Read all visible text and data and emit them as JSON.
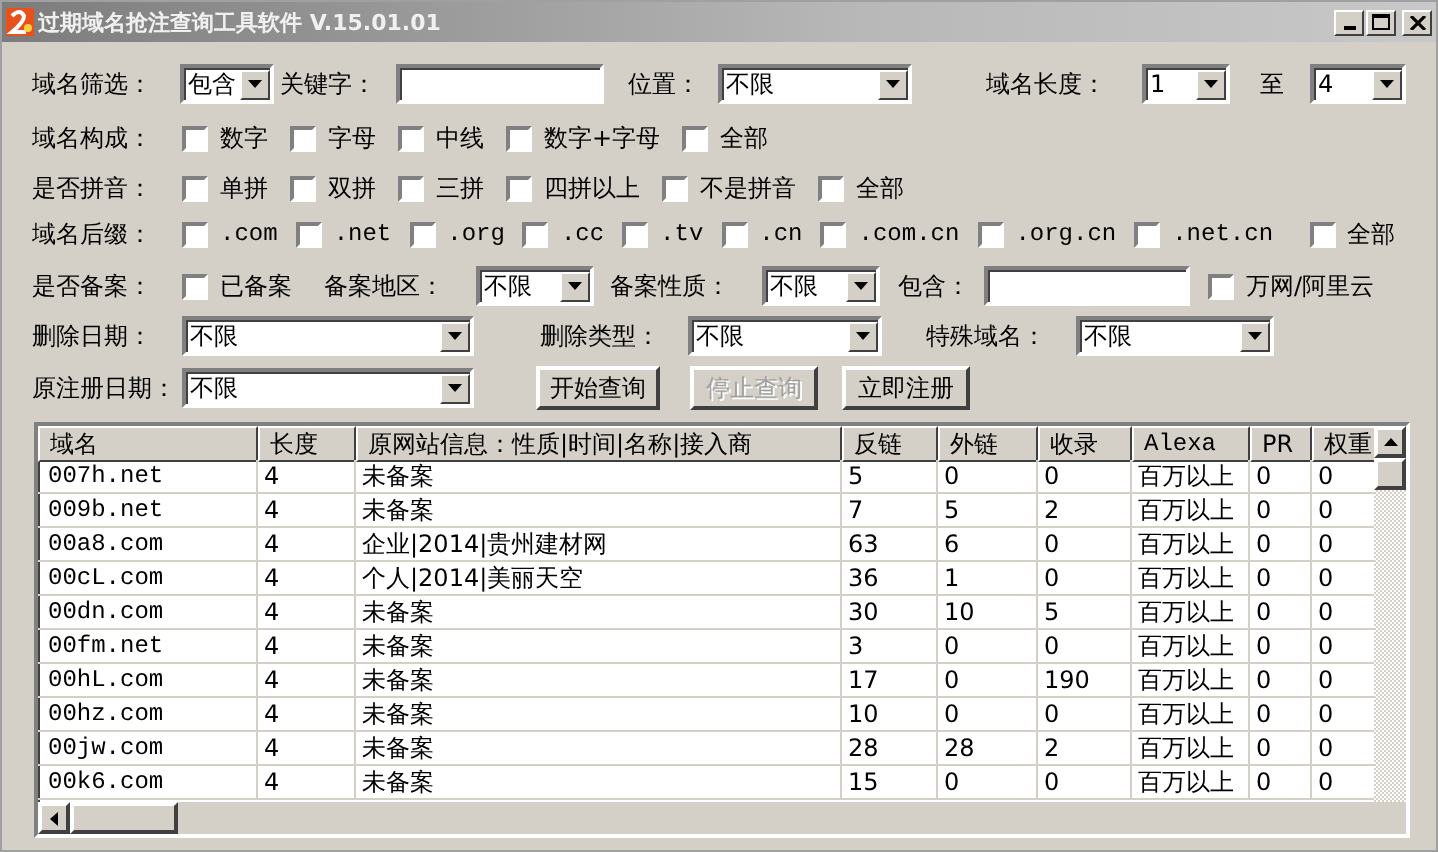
{
  "window": {
    "title": "过期域名抢注查询工具软件 V.15.01.01"
  },
  "form": {
    "rows": [
      {
        "items": [
          {
            "kind": "label",
            "text": "域名筛选："
          },
          {
            "kind": "combo",
            "value": "包含"
          },
          {
            "kind": "label",
            "text": "关键字："
          },
          {
            "kind": "input"
          },
          {
            "kind": "label",
            "text": "位置："
          },
          {
            "kind": "combo",
            "value": "不限"
          },
          {
            "kind": "label",
            "text": "域名长度："
          },
          {
            "kind": "combo",
            "value": "1"
          },
          {
            "kind": "label",
            "text": "至"
          },
          {
            "kind": "combo",
            "value": "4"
          }
        ]
      },
      {
        "items": [
          {
            "kind": "label",
            "text": "域名构成："
          },
          {
            "kind": "check",
            "text": "数字",
            "checked": false
          },
          {
            "kind": "check",
            "text": "字母",
            "checked": false
          },
          {
            "kind": "check",
            "text": "中线",
            "checked": false
          },
          {
            "kind": "check",
            "text": "数字+字母",
            "checked": false
          },
          {
            "kind": "check",
            "text": "全部",
            "checked": false
          }
        ]
      },
      {
        "items": [
          {
            "kind": "label",
            "text": "是否拼音："
          },
          {
            "kind": "check",
            "text": "单拼",
            "checked": false
          },
          {
            "kind": "check",
            "text": "双拼",
            "checked": false
          },
          {
            "kind": "check",
            "text": "三拼",
            "checked": false
          },
          {
            "kind": "check",
            "text": "四拼以上",
            "checked": false
          },
          {
            "kind": "check",
            "text": "不是拼音",
            "checked": false
          },
          {
            "kind": "check",
            "text": "全部",
            "checked": false
          }
        ]
      },
      {
        "items": [
          {
            "kind": "label",
            "text": "域名后缀："
          },
          {
            "kind": "check",
            "text": ".com",
            "checked": false
          },
          {
            "kind": "check",
            "text": ".net",
            "checked": false
          },
          {
            "kind": "check",
            "text": ".org",
            "checked": false
          },
          {
            "kind": "check",
            "text": ".cc",
            "checked": false
          },
          {
            "kind": "check",
            "text": ".tv",
            "checked": false
          },
          {
            "kind": "check",
            "text": ".cn",
            "checked": false
          },
          {
            "kind": "check",
            "text": ".com.cn",
            "checked": false
          },
          {
            "kind": "check",
            "text": ".org.cn",
            "checked": false
          },
          {
            "kind": "check",
            "text": ".net.cn",
            "checked": false
          },
          {
            "kind": "check",
            "text": "全部",
            "checked": false
          }
        ]
      },
      {
        "items": [
          {
            "kind": "label",
            "text": "是否备案："
          },
          {
            "kind": "check",
            "text": "已备案",
            "checked": false
          },
          {
            "kind": "label",
            "text": "备案地区："
          },
          {
            "kind": "combo",
            "value": "不限"
          },
          {
            "kind": "label",
            "text": "备案性质："
          },
          {
            "kind": "combo",
            "value": "不限"
          },
          {
            "kind": "label",
            "text": "包含："
          },
          {
            "kind": "input"
          },
          {
            "kind": "check",
            "text": "万网/阿里云",
            "checked": false
          }
        ]
      },
      {
        "items": [
          {
            "kind": "label",
            "text": "删除日期："
          },
          {
            "kind": "combo",
            "value": "不限"
          },
          {
            "kind": "label",
            "text": "删除类型："
          },
          {
            "kind": "combo",
            "value": "不限"
          },
          {
            "kind": "label",
            "text": "特殊域名："
          },
          {
            "kind": "combo",
            "value": "不限"
          }
        ]
      },
      {
        "items": [
          {
            "kind": "label",
            "text": "原注册日期："
          },
          {
            "kind": "combo",
            "value": "不限"
          },
          {
            "kind": "button",
            "text": "开始查询",
            "disabled": false
          },
          {
            "kind": "button",
            "text": "停止查询",
            "disabled": true
          },
          {
            "kind": "button",
            "text": "立即注册",
            "disabled": false
          }
        ]
      }
    ]
  },
  "table": {
    "columns": [
      "域名",
      "长度",
      "原网站信息：性质|时间|名称|接入商",
      "反链",
      "外链",
      "收录",
      "Alexa",
      "PR",
      "权重"
    ],
    "rows": [
      [
        "007h.net",
        "4",
        "未备案",
        "5",
        "0",
        "0",
        "百万以上",
        "0",
        "0"
      ],
      [
        "009b.net",
        "4",
        "未备案",
        "7",
        "5",
        "2",
        "百万以上",
        "0",
        "0"
      ],
      [
        "00a8.com",
        "4",
        "企业|2014|贵州建材网",
        "63",
        "6",
        "0",
        "百万以上",
        "0",
        "0"
      ],
      [
        "00cL.com",
        "4",
        "个人|2014|美丽天空",
        "36",
        "1",
        "0",
        "百万以上",
        "0",
        "0"
      ],
      [
        "00dn.com",
        "4",
        "未备案",
        "30",
        "10",
        "5",
        "百万以上",
        "0",
        "0"
      ],
      [
        "00fm.net",
        "4",
        "未备案",
        "3",
        "0",
        "0",
        "百万以上",
        "0",
        "0"
      ],
      [
        "00hL.com",
        "4",
        "未备案",
        "17",
        "0",
        "190",
        "百万以上",
        "0",
        "0"
      ],
      [
        "00hz.com",
        "4",
        "未备案",
        "10",
        "0",
        "0",
        "百万以上",
        "0",
        "0"
      ],
      [
        "00jw.com",
        "4",
        "未备案",
        "28",
        "28",
        "2",
        "百万以上",
        "0",
        "0"
      ],
      [
        "00k6.com",
        "4",
        "未备案",
        "15",
        "0",
        "0",
        "百万以上",
        "0",
        "0"
      ]
    ]
  }
}
